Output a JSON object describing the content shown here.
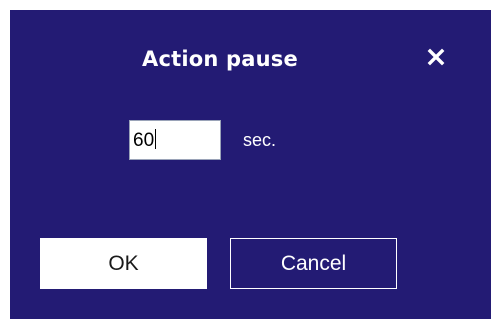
{
  "dialog": {
    "title": "Action pause",
    "close_icon": "close-icon",
    "pause_value": "60",
    "unit_label": "sec.",
    "ok_label": "OK",
    "cancel_label": "Cancel"
  },
  "colors": {
    "dialog_background": "#231b74",
    "text": "#ffffff",
    "ok_button_background": "#ffffff",
    "input_border": "#9aa3b8"
  }
}
